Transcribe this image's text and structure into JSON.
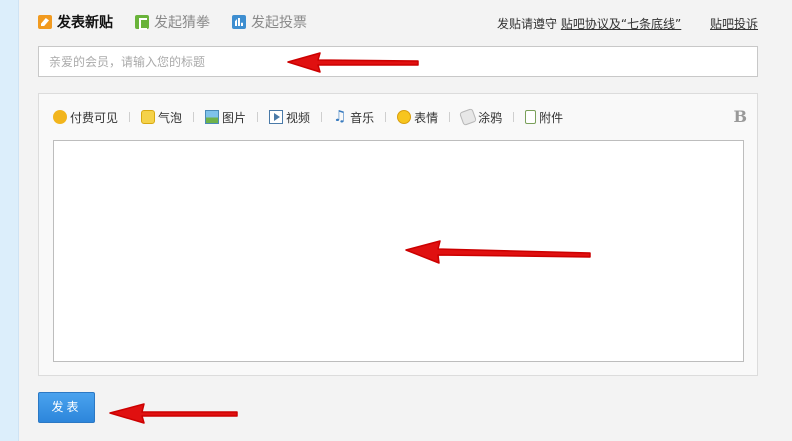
{
  "tabs": [
    {
      "label": "发表新贴",
      "icon": "new-post-icon",
      "active": true
    },
    {
      "label": "发起猜拳",
      "icon": "guess-game-icon",
      "active": false
    },
    {
      "label": "发起投票",
      "icon": "vote-chart-icon",
      "active": false
    }
  ],
  "header": {
    "policy_prefix": "发贴请遵守",
    "policy_link": "贴吧协议及“七条底线”",
    "report_link": "贴吧投诉"
  },
  "title_input": {
    "placeholder": "亲爱的会员，请输入您的标题",
    "value": ""
  },
  "toolbar": {
    "items": [
      {
        "label": "付费可见",
        "icon": "pay-coin-icon"
      },
      {
        "label": "气泡",
        "icon": "bubble-icon"
      },
      {
        "label": "图片",
        "icon": "picture-icon"
      },
      {
        "label": "视频",
        "icon": "video-icon"
      },
      {
        "label": "音乐",
        "icon": "music-icon"
      },
      {
        "label": "表情",
        "icon": "smiley-icon"
      },
      {
        "label": "涂鸦",
        "icon": "doodle-icon"
      },
      {
        "label": "附件",
        "icon": "attachment-icon"
      }
    ],
    "bold_label": "B"
  },
  "editor": {
    "content": ""
  },
  "submit_label": "发表",
  "colors": {
    "accent": "#2d86db",
    "annotation_arrow": "#e01010",
    "left_stripe": "#dceefb"
  }
}
